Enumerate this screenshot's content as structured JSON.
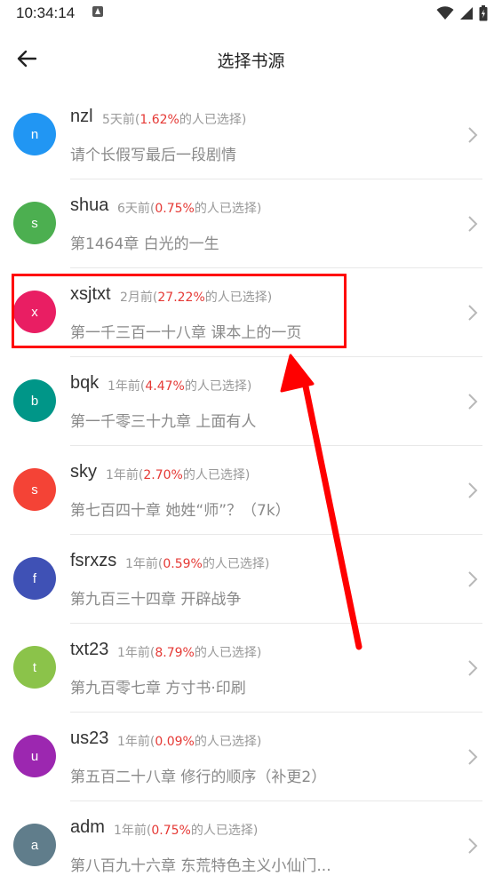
{
  "status_bar": {
    "time": "10:34:14",
    "icons": [
      "notification-icon",
      "wifi-icon",
      "signal-icon",
      "battery-icon"
    ]
  },
  "toolbar": {
    "back_icon": "arrow-left-icon",
    "title": "选择书源"
  },
  "sources": [
    {
      "letter": "n",
      "name": "nzl",
      "time": "5天前(",
      "percent": "1.62%",
      "suffix": "的人已选择)",
      "chapter": "请个长假写最后一段剧情",
      "color": "#2196f3"
    },
    {
      "letter": "s",
      "name": "shua",
      "time": "6天前(",
      "percent": "0.75%",
      "suffix": "的人已选择)",
      "chapter": "第1464章 白光的一生",
      "color": "#4caf50"
    },
    {
      "letter": "x",
      "name": "xsjtxt",
      "time": "2月前(",
      "percent": "27.22%",
      "suffix": "的人已选择)",
      "chapter": "第一千三百一十八章 课本上的一页",
      "color": "#e91e63"
    },
    {
      "letter": "b",
      "name": "bqk",
      "time": "1年前(",
      "percent": "4.47%",
      "suffix": "的人已选择)",
      "chapter": "第一千零三十九章 上面有人",
      "color": "#009688"
    },
    {
      "letter": "s",
      "name": "sky",
      "time": "1年前(",
      "percent": "2.70%",
      "suffix": "的人已选择)",
      "chapter": "第七百四十章 她姓“师”？（7k）",
      "color": "#f44336"
    },
    {
      "letter": "f",
      "name": "fsrxzs",
      "time": "1年前(",
      "percent": "0.59%",
      "suffix": "的人已选择)",
      "chapter": "第九百三十四章 开辟战争",
      "color": "#3f51b5"
    },
    {
      "letter": "t",
      "name": "txt23",
      "time": "1年前(",
      "percent": "8.79%",
      "suffix": "的人已选择)",
      "chapter": "第九百零七章 方寸书·印刷",
      "color": "#8bc34a"
    },
    {
      "letter": "u",
      "name": "us23",
      "time": "1年前(",
      "percent": "0.09%",
      "suffix": "的人已选择)",
      "chapter": "第五百二十八章 修行的顺序（补更2）",
      "color": "#9c27b0"
    },
    {
      "letter": "a",
      "name": "adm",
      "time": "1年前(",
      "percent": "0.75%",
      "suffix": "的人已选择)",
      "chapter": "第八百九十六章 东荒特色主义小仙门...",
      "color": "#607d8b"
    }
  ],
  "annotation": {
    "highlight_color": "#ff0000",
    "highlighted_source": "xsjtxt"
  }
}
